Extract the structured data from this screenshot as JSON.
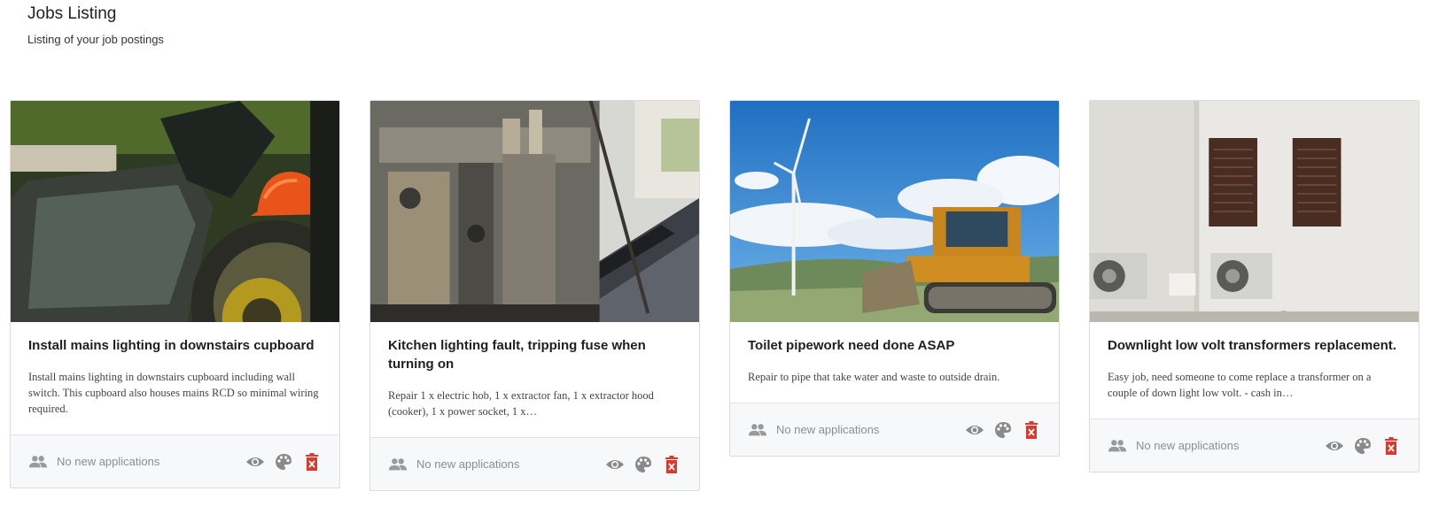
{
  "header": {
    "title": "Jobs Listing",
    "subtitle": "Listing of your job postings"
  },
  "jobs": [
    {
      "title": "Install mains lighting in downstairs cupboard",
      "description": "Install mains lighting in downstairs cupboard including wall switch. This cupboard also houses mains RCD so minimal wiring required.",
      "applications": "No new applications"
    },
    {
      "title": "Kitchen lighting fault, tripping fuse when turning on",
      "description": "Repair 1 x electric hob, 1 x extractor fan, 1 x extractor hood (cooker), 1 x power socket, 1 x…",
      "applications": "No new applications"
    },
    {
      "title": "Toilet pipework need done ASAP",
      "description": "Repair to pipe that take water and waste to outside drain.",
      "applications": "No new applications"
    },
    {
      "title": "Downlight low volt transformers replacement.",
      "description": "Easy job, need someone to come replace a transformer on a couple of down light low volt. - cash in…",
      "applications": "No new applications"
    }
  ],
  "icons": {
    "applications": "people-icon",
    "view": "eye-icon",
    "theme": "palette-icon",
    "delete": "delete-icon"
  },
  "colors": {
    "icon_grey": "#8a8a8a",
    "delete_red": "#d83a2e",
    "footer_bg": "#f7f8fa"
  }
}
